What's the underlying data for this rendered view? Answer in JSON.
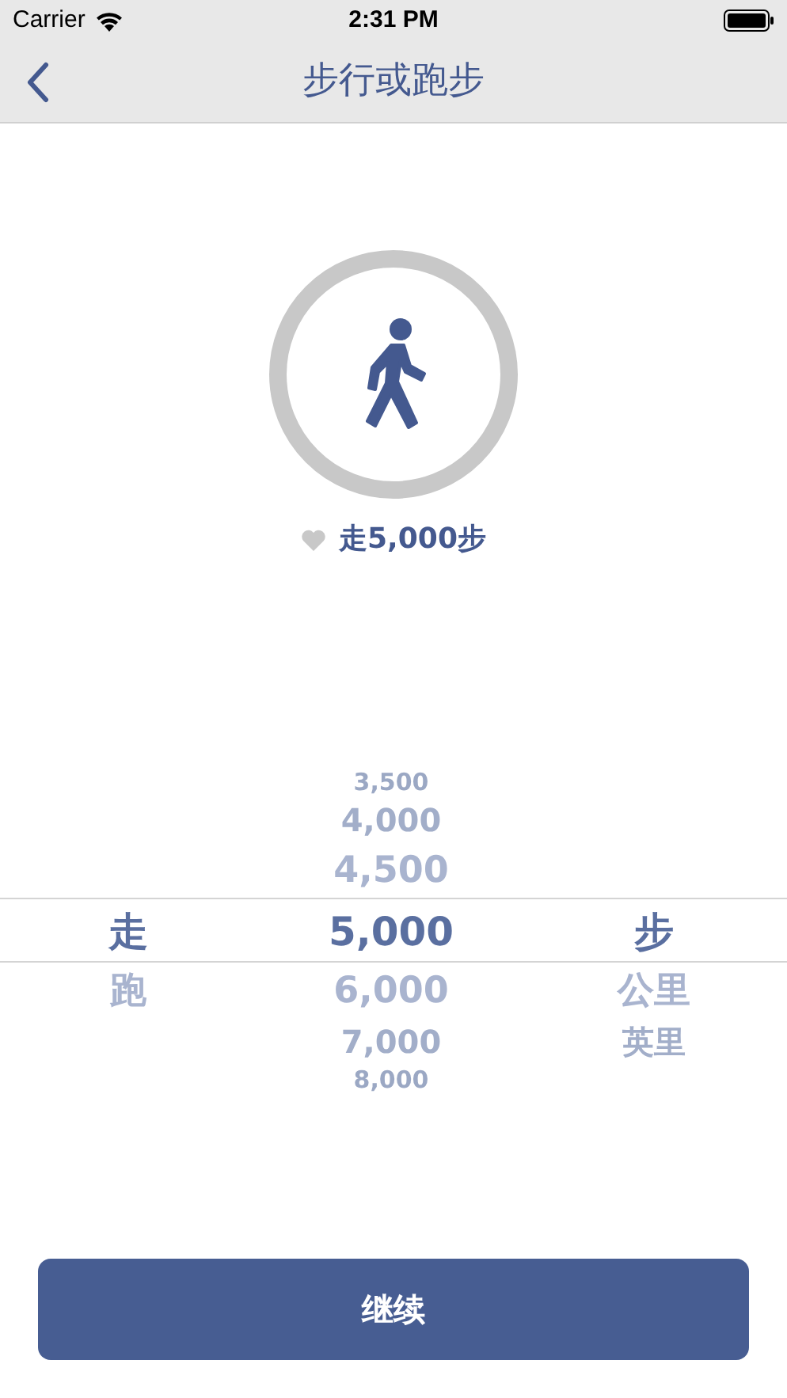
{
  "status_bar": {
    "carrier": "Carrier",
    "time": "2:31 PM"
  },
  "nav": {
    "title": "步行或跑步"
  },
  "goal": {
    "caption": "走5,000步"
  },
  "picker": {
    "columns": [
      {
        "items": [
          {
            "label": "走",
            "selected": true
          },
          {
            "label": "跑",
            "selected": false
          }
        ]
      },
      {
        "items": [
          {
            "label": "3,500",
            "selected": false
          },
          {
            "label": "4,000",
            "selected": false
          },
          {
            "label": "4,500",
            "selected": false
          },
          {
            "label": "5,000",
            "selected": true
          },
          {
            "label": "6,000",
            "selected": false
          },
          {
            "label": "7,000",
            "selected": false
          },
          {
            "label": "8,000",
            "selected": false
          }
        ]
      },
      {
        "items": [
          {
            "label": "步",
            "selected": true
          },
          {
            "label": "公里",
            "selected": false
          },
          {
            "label": "英里",
            "selected": false
          }
        ]
      }
    ]
  },
  "button": {
    "label": "继续"
  }
}
